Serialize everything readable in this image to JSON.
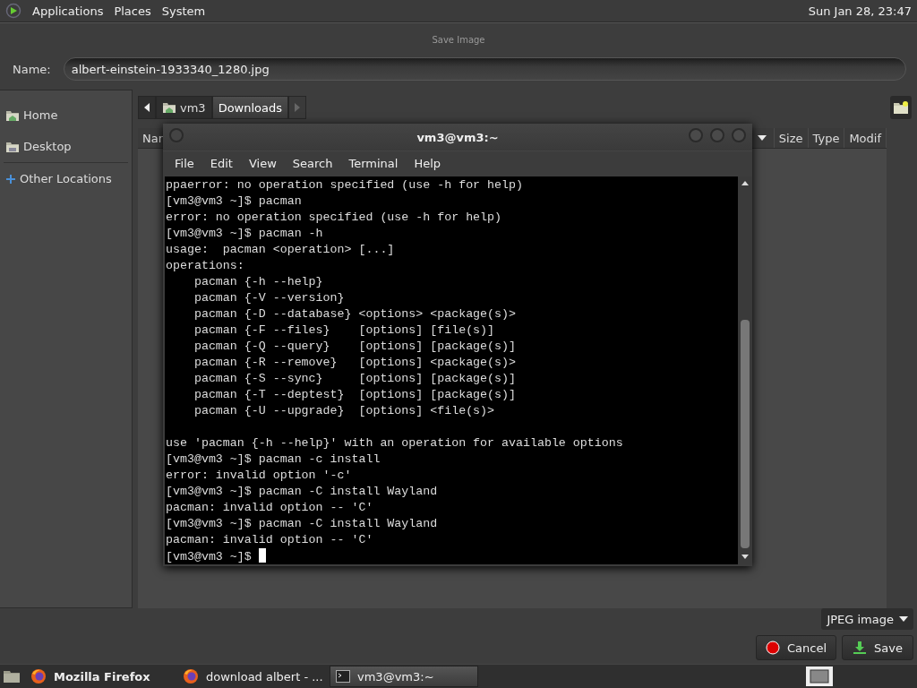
{
  "top_panel": {
    "menus": [
      "Applications",
      "Places",
      "System"
    ],
    "clock": "Sun Jan 28, 23:47"
  },
  "dialog": {
    "title": "Save Image",
    "name_label": "Name:",
    "name_value": "albert-einstein-1933340_1280.jpg",
    "sidebar": {
      "items": [
        {
          "label": "Home",
          "kind": "home",
          "selected": false
        },
        {
          "label": "Desktop",
          "kind": "desktop",
          "selected": false
        },
        {
          "label": "Other Locations",
          "kind": "other",
          "selected": false
        }
      ]
    },
    "path_bar": [
      {
        "label": "vm3",
        "kind": "home",
        "selected": false
      },
      {
        "label": "Downloads",
        "kind": "folder",
        "selected": true
      }
    ],
    "columns": [
      "Nar",
      "Size",
      "Type",
      "Modif"
    ],
    "file_type": "JPEG image",
    "buttons": [
      {
        "label": "Cancel",
        "kind": "cancel"
      },
      {
        "label": "Save",
        "kind": "save"
      }
    ]
  },
  "terminal": {
    "title": "vm3@vm3:~",
    "menu": [
      "File",
      "Edit",
      "View",
      "Search",
      "Terminal",
      "Help"
    ],
    "lines": [
      "ppaerror: no operation specified (use -h for help)",
      "[vm3@vm3 ~]$ pacman",
      "error: no operation specified (use -h for help)",
      "[vm3@vm3 ~]$ pacman -h",
      "usage:  pacman <operation> [...]",
      "operations:",
      "    pacman {-h --help}",
      "    pacman {-V --version}",
      "    pacman {-D --database} <options> <package(s)>",
      "    pacman {-F --files}    [options] [file(s)]",
      "    pacman {-Q --query}    [options] [package(s)]",
      "    pacman {-R --remove}   [options] <package(s)>",
      "    pacman {-S --sync}     [options] [package(s)]",
      "    pacman {-T --deptest}  [options] [package(s)]",
      "    pacman {-U --upgrade}  [options] <file(s)>",
      {
        "text": "use 'pacman {-h --help}' with an operation for available options",
        "blank_before": true
      },
      "[vm3@vm3 ~]$ pacman -c install",
      "error: invalid option '-c'",
      "[vm3@vm3 ~]$ pacman -C install Wayland",
      "pacman: invalid option -- 'C'",
      "[vm3@vm3 ~]$ pacman -C install Wayland",
      "pacman: invalid option -- 'C'",
      "[vm3@vm3 ~]$ "
    ]
  },
  "taskbar": {
    "items": [
      {
        "label": "Mozilla Firefox",
        "kind": "firefox",
        "selected": false,
        "bold": true
      },
      {
        "label": "download albert - ...",
        "kind": "firefox",
        "selected": false,
        "bold": false
      },
      {
        "label": "vm3@vm3:~",
        "kind": "terminal",
        "selected": true,
        "bold": false
      }
    ]
  }
}
